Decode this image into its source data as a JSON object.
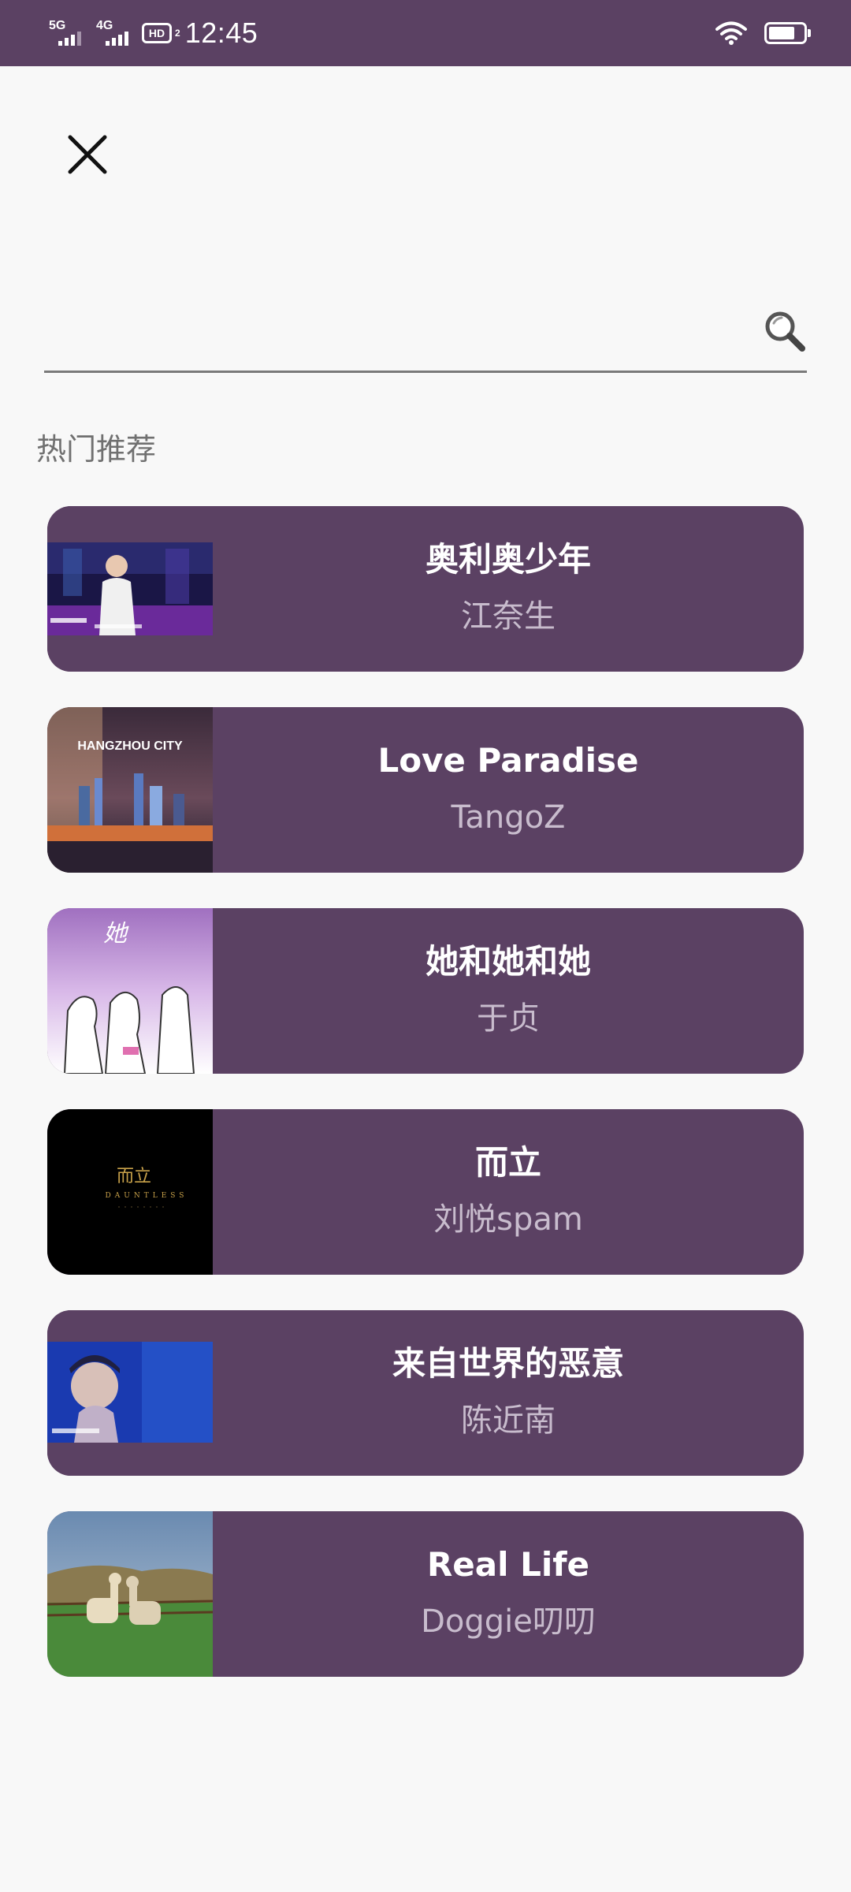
{
  "status_bar": {
    "net1": "5G",
    "net2": "4G",
    "hd": "HD",
    "hd_sub": "2",
    "time": "12:45",
    "icons": [
      "signal-5g-icon",
      "signal-4g-icon",
      "hd-voice-icon",
      "wifi-icon",
      "battery-icon"
    ],
    "battery_level": 0.75
  },
  "header": {
    "close_icon": "close-icon"
  },
  "search": {
    "value": "",
    "placeholder": "",
    "icon": "search-icon"
  },
  "section": {
    "title": "热门推荐"
  },
  "songs": [
    {
      "title": "奥利奥少年",
      "artist": "江奈生",
      "cover": "concert-stage-cover",
      "cover_text": "…"
    },
    {
      "title": "Love Paradise",
      "artist": "TangoZ",
      "cover": "city-skyline-cover",
      "cover_text": "HANGZHOU CITY"
    },
    {
      "title": "她和她和她",
      "artist": "于贞",
      "cover": "three-girls-sketch-cover",
      "cover_text": "她"
    },
    {
      "title": "而立",
      "artist": "刘悦spam",
      "cover": "black-title-cover",
      "cover_text": "而立",
      "cover_subtext": "DAUNTLESS"
    },
    {
      "title": "来自世界的恶意",
      "artist": "陈近南",
      "cover": "blue-portrait-cover"
    },
    {
      "title": "Real Life",
      "artist": "Doggie叨叨",
      "cover": "alpaca-field-cover"
    }
  ],
  "colors": {
    "accent": "#5b4163",
    "card_title": "#ffffff",
    "card_artist": "#c8bccd",
    "background": "#f8f8f8"
  }
}
